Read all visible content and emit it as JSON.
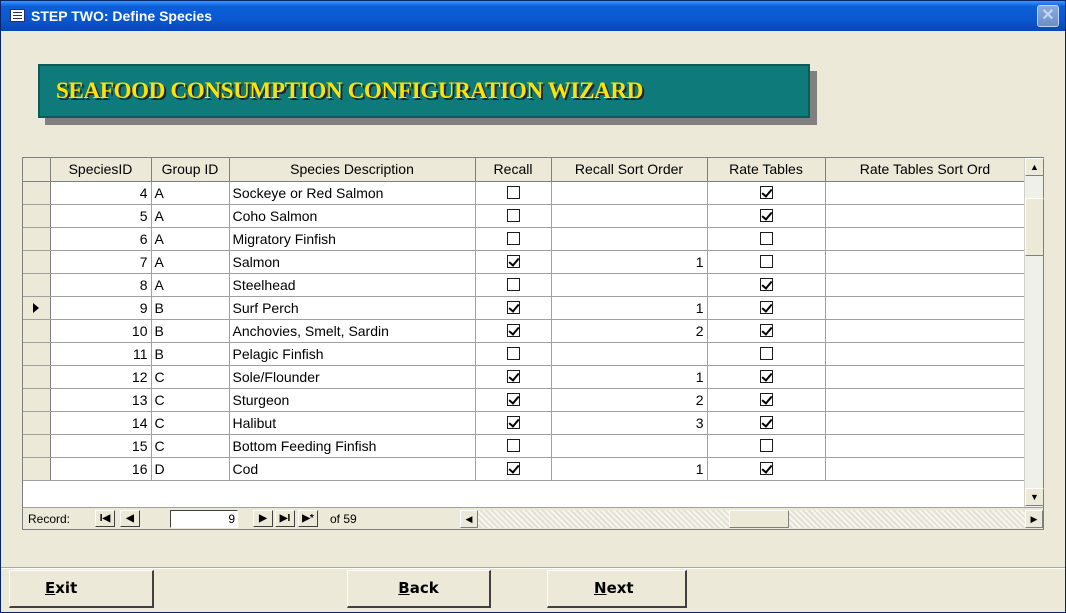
{
  "window": {
    "title": "STEP TWO:  Define Species",
    "close_glyph": "✕"
  },
  "banner": {
    "text": "SEAFOOD CONSUMPTION CONFIGURATION WIZARD"
  },
  "grid": {
    "columns": [
      "",
      "SpeciesID",
      "Group ID",
      "Species Description",
      "Recall",
      "Recall Sort Order",
      "Rate Tables",
      "Rate Tables Sort Ord"
    ],
    "current_row_index": 5,
    "rows": [
      {
        "id": "4",
        "group": "A",
        "desc": "Sockeye or Red Salmon",
        "recall": false,
        "recall_sort": "",
        "rate": true,
        "rate_sort": ""
      },
      {
        "id": "5",
        "group": "A",
        "desc": "Coho Salmon",
        "recall": false,
        "recall_sort": "",
        "rate": true,
        "rate_sort": ""
      },
      {
        "id": "6",
        "group": "A",
        "desc": "Migratory Finfish",
        "recall": false,
        "recall_sort": "",
        "rate": false,
        "rate_sort": ""
      },
      {
        "id": "7",
        "group": "A",
        "desc": "Salmon",
        "recall": true,
        "recall_sort": "1",
        "rate": false,
        "rate_sort": ""
      },
      {
        "id": "8",
        "group": "A",
        "desc": "Steelhead",
        "recall": false,
        "recall_sort": "",
        "rate": true,
        "rate_sort": ""
      },
      {
        "id": "9",
        "group": "B",
        "desc": "Surf Perch",
        "recall": true,
        "recall_sort": "1",
        "rate": true,
        "rate_sort": ""
      },
      {
        "id": "10",
        "group": "B",
        "desc": "Anchovies, Smelt, Sardin",
        "recall": true,
        "recall_sort": "2",
        "rate": true,
        "rate_sort": ""
      },
      {
        "id": "11",
        "group": "B",
        "desc": "Pelagic Finfish",
        "recall": false,
        "recall_sort": "",
        "rate": false,
        "rate_sort": ""
      },
      {
        "id": "12",
        "group": "C",
        "desc": "Sole/Flounder",
        "recall": true,
        "recall_sort": "1",
        "rate": true,
        "rate_sort": ""
      },
      {
        "id": "13",
        "group": "C",
        "desc": "Sturgeon",
        "recall": true,
        "recall_sort": "2",
        "rate": true,
        "rate_sort": ""
      },
      {
        "id": "14",
        "group": "C",
        "desc": "Halibut",
        "recall": true,
        "recall_sort": "3",
        "rate": true,
        "rate_sort": ""
      },
      {
        "id": "15",
        "group": "C",
        "desc": "Bottom Feeding Finfish",
        "recall": false,
        "recall_sort": "",
        "rate": false,
        "rate_sort": ""
      },
      {
        "id": "16",
        "group": "D",
        "desc": "Cod",
        "recall": true,
        "recall_sort": "1",
        "rate": true,
        "rate_sort": ""
      }
    ]
  },
  "navigator": {
    "label": "Record:",
    "first_glyph": "I◀",
    "prev_glyph": "◀",
    "current": "9",
    "next_glyph": "▶",
    "last_glyph": "▶I",
    "new_glyph": "▶*",
    "of_text": "of 59"
  },
  "scroll": {
    "up": "▲",
    "down": "▼",
    "left": "◀",
    "right": "▶"
  },
  "buttons": {
    "exit_u": "E",
    "exit_rest": "xit",
    "back_u": "B",
    "back_rest": "ack",
    "next_u": "N",
    "next_rest": "ext"
  }
}
